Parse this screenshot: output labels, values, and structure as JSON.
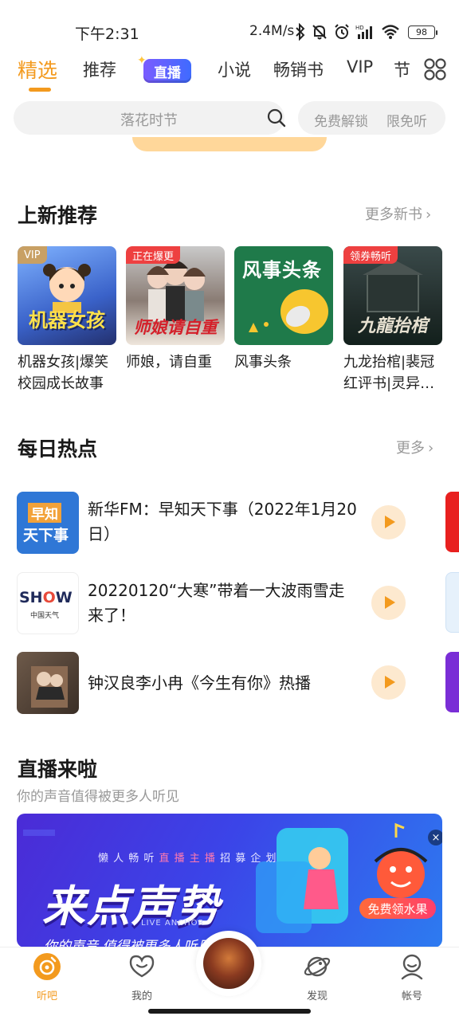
{
  "status_bar": {
    "time": "下午2:31",
    "net_speed": "2.4M/s",
    "battery": "98"
  },
  "tabs": [
    {
      "label": "精选",
      "active": true
    },
    {
      "label": "推荐"
    },
    {
      "label": "直播"
    },
    {
      "label": "小说"
    },
    {
      "label": "畅销书"
    },
    {
      "label": "VIP"
    },
    {
      "label": "节"
    }
  ],
  "search": {
    "placeholder": "落花时节",
    "promo_1": "免费解锁",
    "promo_2": "限免听"
  },
  "new_books": {
    "title": "上新推荐",
    "more": "更多新书",
    "items": [
      {
        "title": "机器女孩|爆笑校园成长故事",
        "badge": "VIP",
        "cover_text": "机器女孩",
        "badge_color": "#c8a064"
      },
      {
        "title": "师娘，请自重",
        "badge": "正在爆更",
        "cover_text": "师娘请自重",
        "badge_color": "#ee4040"
      },
      {
        "title": "风事头条",
        "badge": "",
        "cover_text": "风事头条",
        "badge_color": ""
      },
      {
        "title": "九龙抬棺|裴冠红评书|灵异…",
        "badge": "领券畅听",
        "cover_text": "九龍抬棺",
        "badge_color": "#ee4040"
      }
    ]
  },
  "hot_news": {
    "title": "每日热点",
    "more": "更多",
    "items": [
      {
        "title": "新华FM：早知天下事（2022年1月20日）",
        "thumb_text_1": "早知",
        "thumb_text_2": "天下事"
      },
      {
        "title": "20220120“大寒”带着一大波雨雪走来了！",
        "thumb_text_1": "SH",
        "thumb_text_2": "W",
        "thumb_sub": "中国天气"
      },
      {
        "title": "钟汉良李小冉《今生有你》热播",
        "thumb_text_1": "",
        "thumb_text_2": ""
      }
    ]
  },
  "live": {
    "title": "直播来啦",
    "subtitle": "你的声音值得被更多人听见",
    "banner_top_a": "懒 人 畅 听 ",
    "banner_top_b": "直 播 主 播",
    "banner_top_c": " 招 募 企 划",
    "banner_main": "来点声势",
    "banner_anchor": "LIVE ANCHOR",
    "banner_bottom": "你的声音  值得被更多人听见",
    "banner_cta": "免费领水果",
    "banner_close": "×"
  },
  "bottom_nav": [
    {
      "label": "听吧",
      "icon": "listen-icon",
      "active": true
    },
    {
      "label": "我的",
      "icon": "heart-face-icon"
    },
    {
      "label": "发现",
      "icon": "planet-icon"
    },
    {
      "label": "帐号",
      "icon": "account-icon"
    }
  ],
  "colors": {
    "accent": "#f39a1e",
    "live_pill": "#5b63ff"
  }
}
